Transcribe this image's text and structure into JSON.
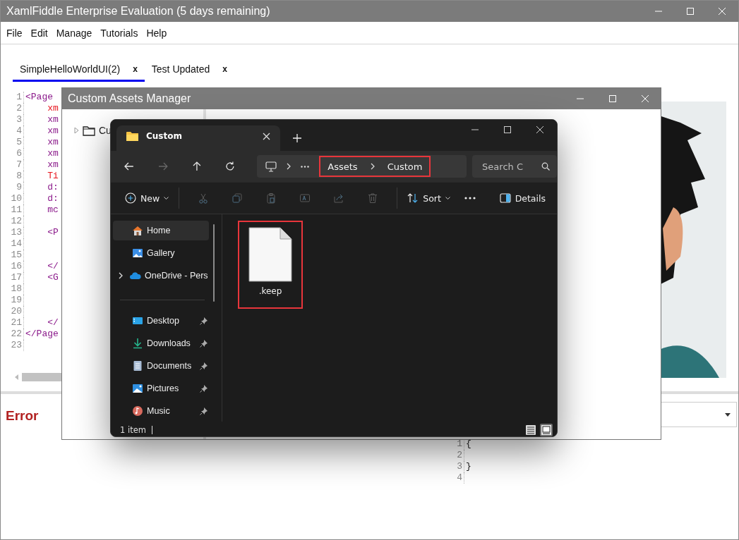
{
  "app": {
    "title": "XamlFiddle Enterprise Evaluation (5 days remaining)",
    "menu": [
      "File",
      "Edit",
      "Manage",
      "Tutorials",
      "Help"
    ],
    "tabs": [
      {
        "label": "SimpleHelloWorldUI(2)",
        "close": "x",
        "selected": true
      },
      {
        "label": "Test Updated",
        "close": "x",
        "selected": false
      }
    ],
    "editor": {
      "lines": [
        {
          "number": "1",
          "text": "<Page",
          "kind": "tag"
        },
        {
          "number": "2",
          "text": "    xm",
          "kind": "attribute"
        },
        {
          "number": "3",
          "text": "    xm",
          "kind": "tag"
        },
        {
          "number": "4",
          "text": "    xm",
          "kind": "tag"
        },
        {
          "number": "5",
          "text": "    xm",
          "kind": "tag"
        },
        {
          "number": "6",
          "text": "    xm",
          "kind": "tag"
        },
        {
          "number": "7",
          "text": "    xm",
          "kind": "tag"
        },
        {
          "number": "8",
          "text": "    Ti",
          "kind": "attribute"
        },
        {
          "number": "9",
          "text": "    d:",
          "kind": "tag"
        },
        {
          "number": "10",
          "text": "    d:",
          "kind": "tag"
        },
        {
          "number": "11",
          "text": "    mc",
          "kind": "tag"
        },
        {
          "number": "12"
        },
        {
          "number": "13",
          "text": "    <P",
          "kind": "tag"
        },
        {
          "number": "14"
        },
        {
          "number": "15"
        },
        {
          "number": "16",
          "text": "    </",
          "kind": "tag"
        },
        {
          "number": "17",
          "text": "    <G",
          "kind": "tag"
        },
        {
          "number": "18"
        },
        {
          "number": "19"
        },
        {
          "number": "20"
        },
        {
          "number": "21",
          "text": "    </",
          "kind": "tag"
        },
        {
          "number": "22",
          "text": "</Page",
          "kind": "tag"
        },
        {
          "number": "23"
        }
      ]
    },
    "preview": {
      "kind": "picture"
    },
    "error_panel": {
      "title": "Error"
    },
    "output": {
      "lines": [
        {
          "number": "1",
          "text": "{"
        },
        {
          "number": "2"
        },
        {
          "number": "3",
          "text": "}"
        },
        {
          "number": "4"
        }
      ]
    }
  },
  "dialog": {
    "title": "Custom Assets Manager",
    "tree": [
      {
        "label": "Cu",
        "expanded": false
      }
    ]
  },
  "explorer": {
    "tab": {
      "label": "Custom"
    },
    "nav_buttons": [
      {
        "kind": "back",
        "disabled": false
      },
      {
        "kind": "forward",
        "disabled": true
      },
      {
        "kind": "up",
        "disabled": false
      },
      {
        "kind": "refresh",
        "disabled": false
      }
    ],
    "address": {
      "segments": [
        "Assets",
        "Custom"
      ],
      "highlighted": true
    },
    "search": {
      "placeholder": "Search C"
    },
    "toolbar": {
      "new_label": "New",
      "actions": [
        {
          "kind": "cut",
          "disabled": true
        },
        {
          "kind": "copy",
          "disabled": true
        },
        {
          "kind": "paste",
          "disabled": true
        },
        {
          "kind": "rename",
          "disabled": true
        },
        {
          "kind": "share",
          "disabled": true
        },
        {
          "kind": "delete",
          "disabled": true
        }
      ],
      "sort_label": "Sort",
      "details_label": "Details"
    },
    "nav_top": [
      {
        "label": "Home",
        "kind": "home",
        "selected": true,
        "expandable": false
      },
      {
        "label": "Gallery",
        "kind": "gallery",
        "selected": false,
        "expandable": false
      },
      {
        "label": "OneDrive - Pers",
        "kind": "cloud",
        "selected": false,
        "expandable": true
      }
    ],
    "quick_access": [
      {
        "label": "Desktop",
        "kind": "desktop",
        "pinned": true
      },
      {
        "label": "Downloads",
        "kind": "downloads",
        "pinned": true
      },
      {
        "label": "Documents",
        "kind": "documents",
        "pinned": true
      },
      {
        "label": "Pictures",
        "kind": "pictures",
        "pinned": true
      },
      {
        "label": "Music",
        "kind": "music",
        "pinned": true
      }
    ],
    "files": [
      {
        "name": ".keep",
        "highlighted": true
      }
    ],
    "status": "1 item",
    "views": [
      {
        "kind": "details",
        "selected": false
      },
      {
        "kind": "tiles",
        "selected": true
      }
    ]
  }
}
